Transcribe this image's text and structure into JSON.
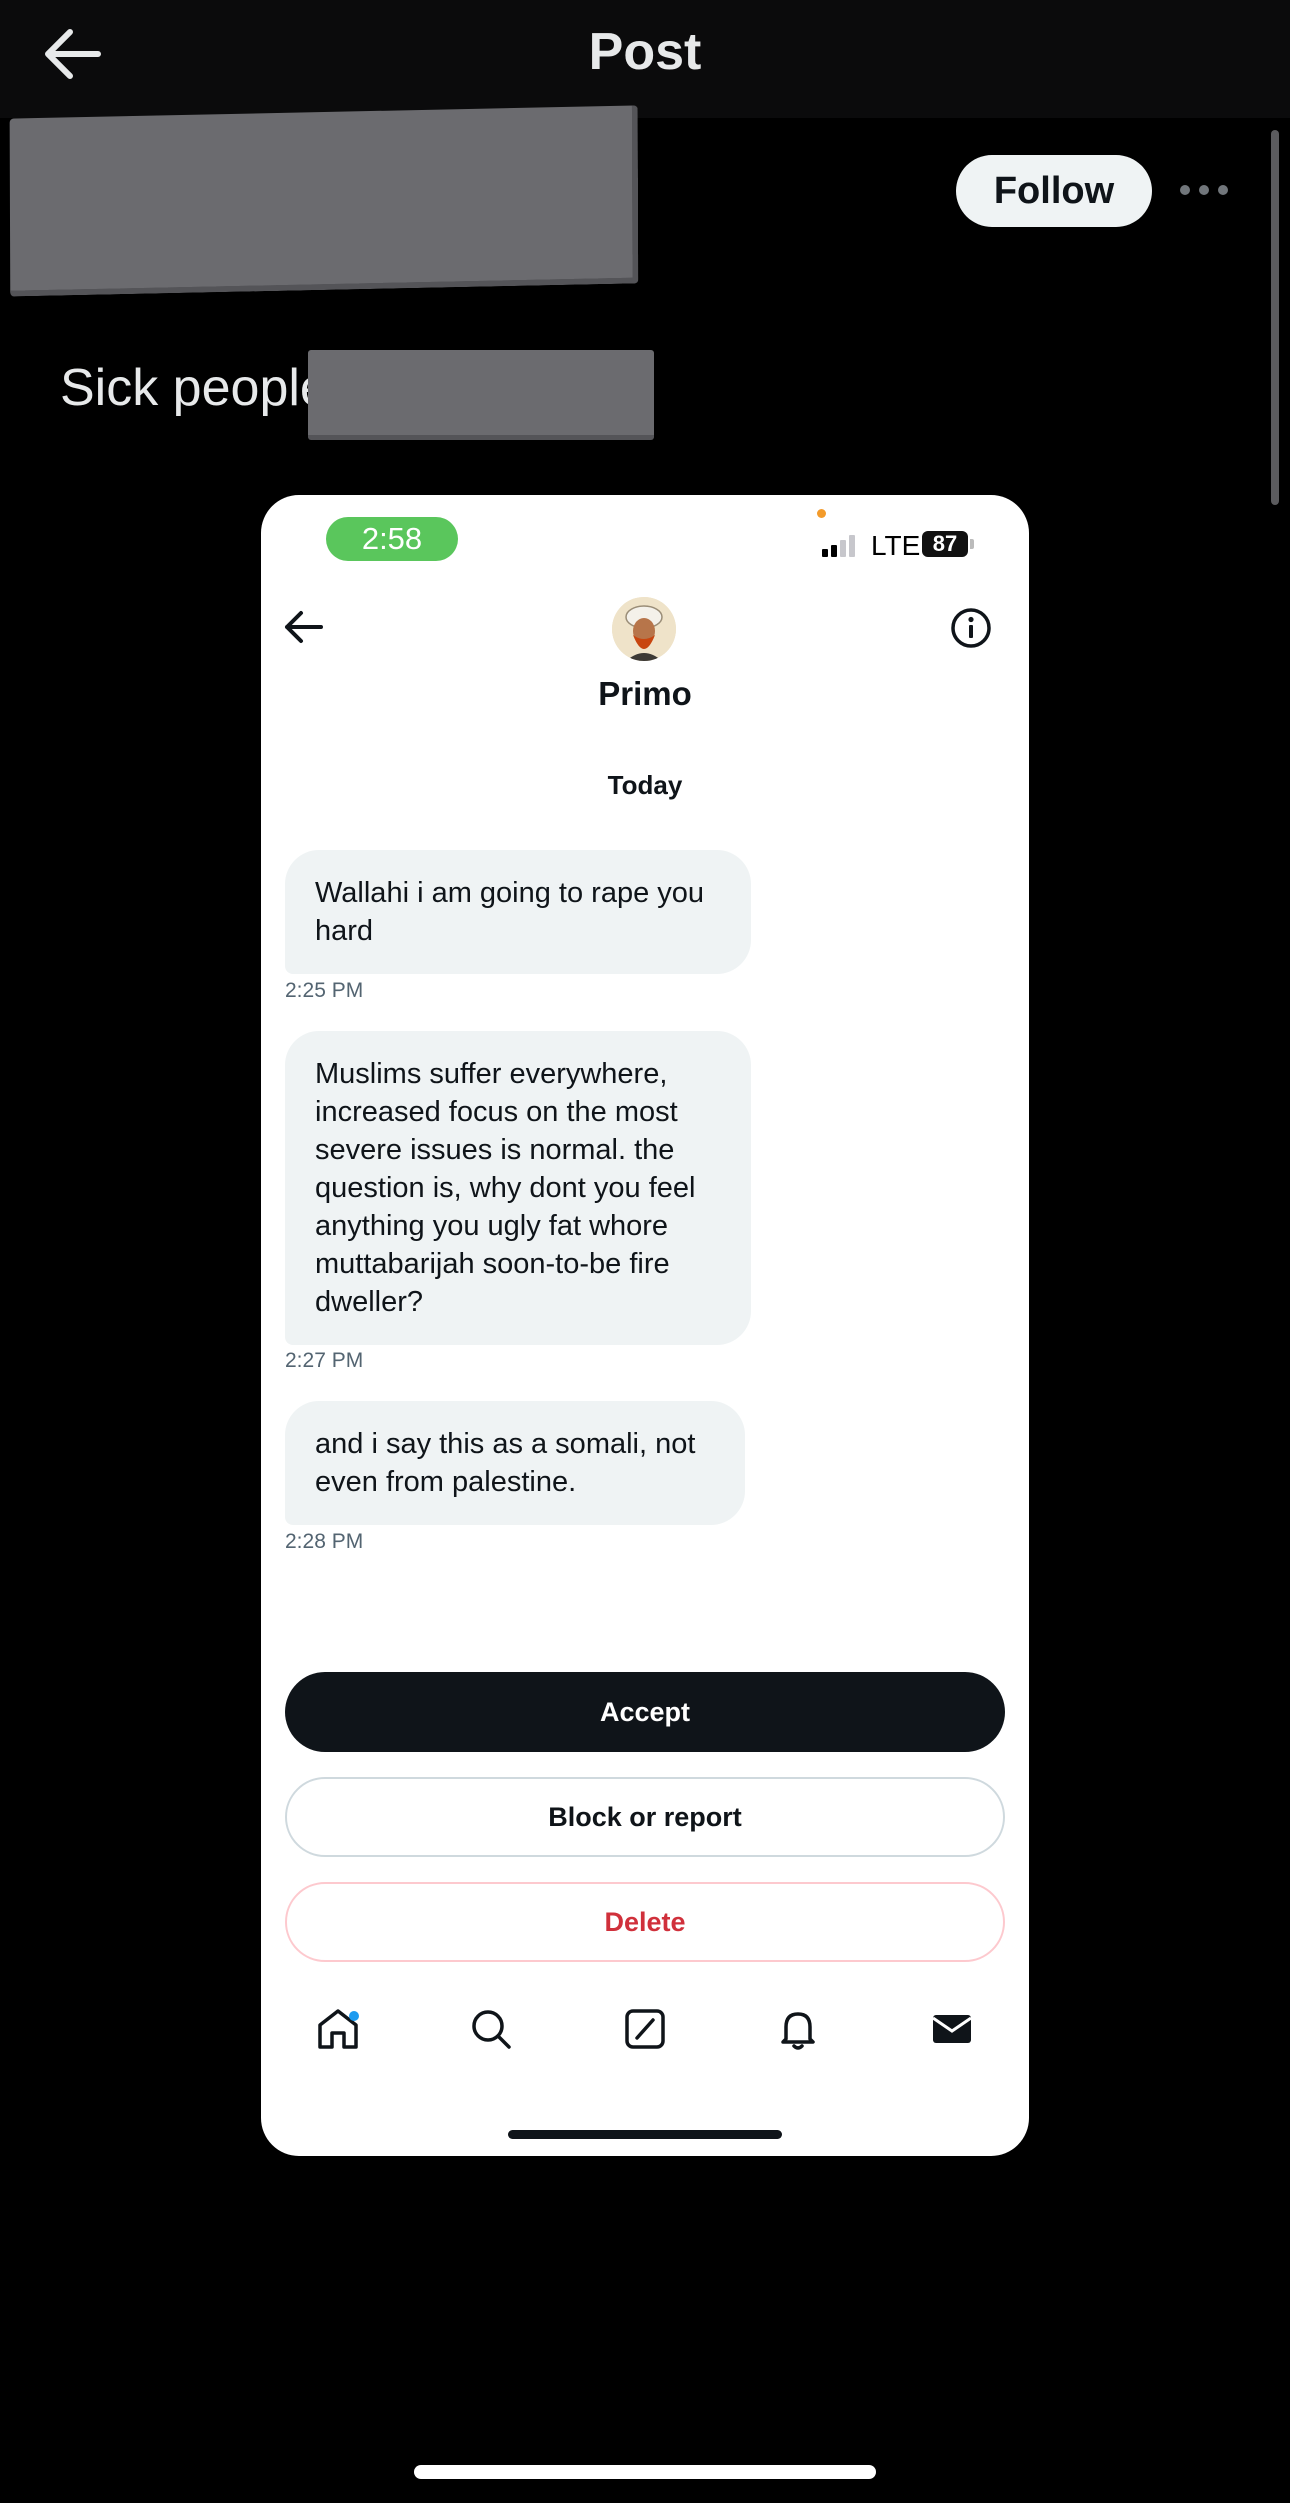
{
  "header": {
    "title": "Post"
  },
  "post": {
    "follow_label": "Follow",
    "text": "Sick people"
  },
  "embedded": {
    "status": {
      "time": "2:58",
      "network": "LTE",
      "battery": "87"
    },
    "conversation": {
      "name": "Primo",
      "day": "Today",
      "messages": [
        {
          "text": "Wallahi i am going to rape you hard",
          "time": "2:25 PM"
        },
        {
          "text": "Muslims suffer everywhere, increased focus on the most severe issues is normal. the question is, why dont you feel anything you ugly fat whore muttabarijah soon-to-be fire dweller?",
          "time": "2:27 PM"
        },
        {
          "text": "and i say this as a somali, not even from palestine.",
          "time": "2:28 PM"
        }
      ]
    },
    "actions": {
      "accept": "Accept",
      "block": "Block or report",
      "delete": "Delete"
    },
    "tabs": [
      "home-icon",
      "search-icon",
      "compose-icon",
      "bell-icon",
      "mail-icon"
    ]
  },
  "colors": {
    "accent": "#1d9bf0",
    "delete": "#d0303b",
    "status_green": "#5ac65c"
  }
}
